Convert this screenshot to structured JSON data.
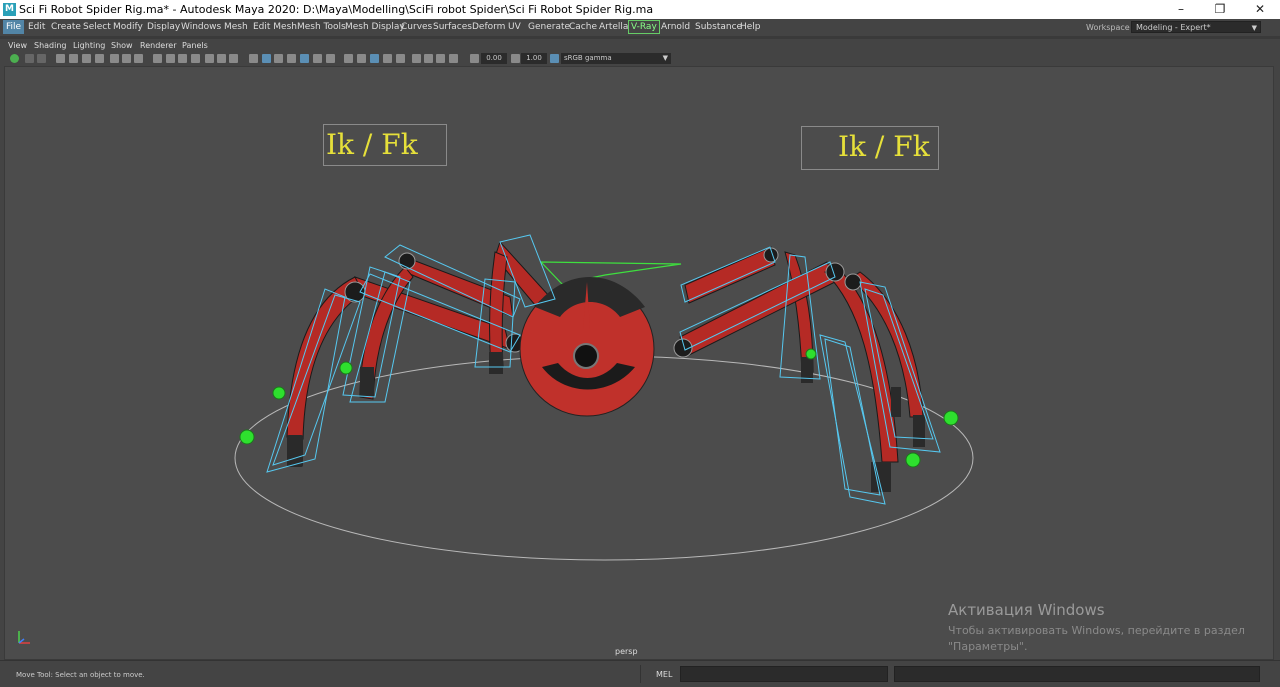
{
  "window": {
    "app_icon": "M",
    "title": "Sci Fi Robot Spider Rig.ma* - Autodesk Maya 2020: D:\\Maya\\Modelling\\SciFi robot Spider\\Sci Fi Robot Spider Rig.ma",
    "minimize": "–",
    "restore": "❐",
    "close": "✕"
  },
  "menubar": {
    "items": [
      "File",
      "Edit",
      "Create",
      "Select",
      "Modify",
      "Display",
      "Windows",
      "Mesh",
      "Edit Mesh",
      "Mesh Tools",
      "Mesh Display",
      "Curves",
      "Surfaces",
      "Deform",
      "UV",
      "Generate",
      "Cache",
      "Arnold",
      "Substance",
      "Help"
    ],
    "artella": "Artella",
    "vray": "V-Ray",
    "workspace_label": "Workspace :",
    "workspace_value": "Modeling - Expert*"
  },
  "panel_menu": [
    "View",
    "Shading",
    "Lighting",
    "Show",
    "Renderer",
    "Panels"
  ],
  "toolbar": {
    "field_1": "0.00",
    "field_2": "1.00",
    "color_space": "sRGB gamma"
  },
  "viewport": {
    "ikfk_left": "Ik / Fk",
    "ikfk_right": "Ik / Fk",
    "camera": "persp",
    "colors": {
      "body_red": "#c0312b",
      "cage_blue": "#56c8f0",
      "control_green": "#3ee03e",
      "label_yellow": "#e6e03a"
    }
  },
  "watermark": {
    "title": "Активация Windows",
    "line1": "Чтобы активировать Windows, перейдите в раздел",
    "line2": "\"Параметры\"."
  },
  "statusbar": {
    "help_line": "Move Tool: Select an object to move.",
    "mel": "MEL"
  }
}
